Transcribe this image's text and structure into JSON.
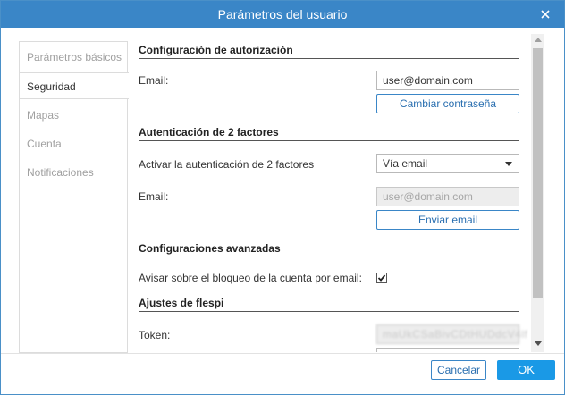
{
  "window": {
    "title": "Parámetros del usuario"
  },
  "sidebar": {
    "items": [
      {
        "label": "Parámetros básicos",
        "active": false
      },
      {
        "label": "Seguridad",
        "active": true
      },
      {
        "label": "Mapas",
        "active": false
      },
      {
        "label": "Cuenta",
        "active": false
      },
      {
        "label": "Notificaciones",
        "active": false
      }
    ]
  },
  "auth": {
    "title": "Configuración de autorización",
    "email_label": "Email:",
    "email_value": "user@domain.com",
    "change_password": "Cambiar contraseña"
  },
  "two_factor": {
    "title": "Autenticación de 2 factores",
    "enable_label": "Activar la autenticación de 2 factores",
    "method_value": "Vía email",
    "email_label": "Email:",
    "email_placeholder": "user@domain.com",
    "send_email": "Enviar email"
  },
  "advanced": {
    "title": "Configuraciones avanzadas",
    "lock_notice_label": "Avisar sobre el bloqueo de la cuenta por email:",
    "lock_notice_checked": true
  },
  "flespi": {
    "title": "Ajustes de flespi",
    "token_label": "Token:",
    "token_value": "maUkCSaBivCDtHUDdcV4lf"
  },
  "footer": {
    "cancel": "Cancelar",
    "ok": "OK"
  },
  "colors": {
    "titlebar": "#3a86c7",
    "ok_button": "#1a99e6",
    "outline": "#3a86c7"
  },
  "icons": {
    "close": "close-icon",
    "dropdown": "chevron-down-icon",
    "check": "checkmark-icon"
  }
}
